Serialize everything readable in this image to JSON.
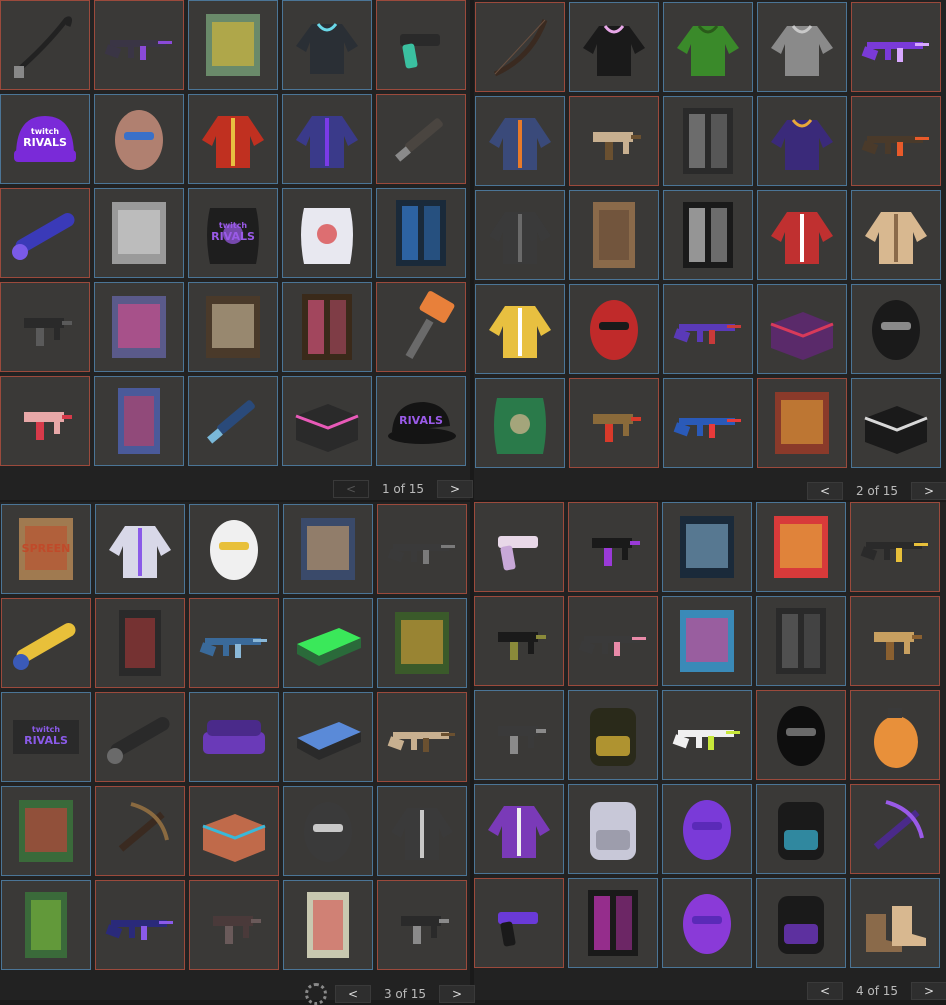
{
  "pages": [
    {
      "pager": {
        "prev": "<",
        "label": "1 of 15",
        "next": ">"
      },
      "items": [
        {
          "n": "whip-icon",
          "k": "whip",
          "f": "r",
          "c": "#222",
          "a": "#888"
        },
        {
          "n": "assault-rifle-icon",
          "k": "rifle",
          "f": "r",
          "c": "#3a3545",
          "a": "#8a4ad8"
        },
        {
          "n": "retro-sign-icon",
          "k": "sign",
          "f": "b",
          "c": "#6a8a6a",
          "a": "#e8c030"
        },
        {
          "n": "hoodie-icon",
          "k": "hoodie",
          "f": "b",
          "c": "#2a2f35",
          "a": "#6ad8e8"
        },
        {
          "n": "revolver-icon",
          "k": "pistol",
          "f": "r",
          "c": "#2a2a2a",
          "a": "#3ac0a0"
        },
        {
          "n": "beanie-icon",
          "k": "beanie",
          "f": "b",
          "c": "#7a2ad8",
          "a": "#ffffff",
          "t": "twitch\nRIVALS"
        },
        {
          "n": "welding-mask-icon",
          "k": "mask",
          "f": "b",
          "c": "#b08070",
          "a": "#3a70c8"
        },
        {
          "n": "jacket-icon",
          "k": "jacket",
          "f": "b",
          "c": "#c03020",
          "a": "#e8c040"
        },
        {
          "n": "jacket-icon",
          "k": "jacket",
          "f": "b",
          "c": "#3a3a8a",
          "a": "#7a3ae8"
        },
        {
          "n": "machete-icon",
          "k": "blade",
          "f": "r",
          "c": "#4a4540",
          "a": "#8a8a8a"
        },
        {
          "n": "rocket-launcher-icon",
          "k": "tube",
          "f": "r",
          "c": "#3a3ab8",
          "a": "#7a5ae8"
        },
        {
          "n": "rug-icon",
          "k": "sign",
          "f": "b",
          "c": "#9a9a9a",
          "a": "#d8d8d8"
        },
        {
          "n": "sleeping-bag-icon",
          "k": "bag",
          "f": "b",
          "c": "#1e1e1e",
          "a": "#9a5ae8",
          "t": "twitch\nRIVALS"
        },
        {
          "n": "sleeping-bag-icon",
          "k": "bag",
          "f": "b",
          "c": "#e8e8f0",
          "a": "#d83a3a"
        },
        {
          "n": "vending-machine-icon",
          "k": "locker",
          "f": "b",
          "c": "#1a2a3a",
          "a": "#3a8ae8"
        },
        {
          "n": "smg-icon",
          "k": "smg",
          "f": "r",
          "c": "#2a2a2a",
          "a": "#5a5a5a"
        },
        {
          "n": "poster-icon",
          "k": "sign",
          "f": "b",
          "c": "#5a5a8a",
          "a": "#e84a8a"
        },
        {
          "n": "poster-icon",
          "k": "sign",
          "f": "b",
          "c": "#4a3a2a",
          "a": "#d8c8a8"
        },
        {
          "n": "locker-icon",
          "k": "locker",
          "f": "b",
          "c": "#3a2a1a",
          "a": "#e85a8a"
        },
        {
          "n": "hammer-icon",
          "k": "hammer",
          "f": "r",
          "c": "#6a6a6a",
          "a": "#e8803a"
        },
        {
          "n": "smg-icon",
          "k": "smg",
          "f": "r",
          "c": "#e8a8a8",
          "a": "#d83a4a"
        },
        {
          "n": "door-icon",
          "k": "door",
          "f": "b",
          "c": "#4a5a9a",
          "a": "#d83a5a"
        },
        {
          "n": "launcher-icon",
          "k": "blade",
          "f": "b",
          "c": "#2a4a7a",
          "a": "#7ab8d8"
        },
        {
          "n": "storage-box-icon",
          "k": "box",
          "f": "b",
          "c": "#2a2a2a",
          "a": "#e85ab8"
        },
        {
          "n": "cap-icon",
          "k": "cap",
          "f": "b",
          "c": "#141414",
          "a": "#9a5ae8",
          "t": "RIVALS"
        }
      ]
    },
    {
      "pager": {
        "prev": "<",
        "label": "2 of 15",
        "next": ">"
      },
      "items": [
        {
          "n": "bow-icon",
          "k": "bow",
          "f": "r",
          "c": "#3a2a20",
          "a": "#6a5040"
        },
        {
          "n": "hoodie-icon",
          "k": "hoodie",
          "f": "b",
          "c": "#1a1a1a",
          "a": "#e8a8e8"
        },
        {
          "n": "hoodie-icon",
          "k": "hoodie",
          "f": "b",
          "c": "#3a8a2a",
          "a": "#2a5a1a"
        },
        {
          "n": "hoodie-icon",
          "k": "hoodie",
          "f": "b",
          "c": "#8a8a8a",
          "a": "#c8c8c8"
        },
        {
          "n": "assault-rifle-icon",
          "k": "rifle",
          "f": "r",
          "c": "#7a3ad8",
          "a": "#d8a8ff"
        },
        {
          "n": "jersey-icon",
          "k": "jacket",
          "f": "b",
          "c": "#3a4a7a",
          "a": "#e87a2a"
        },
        {
          "n": "thompson-icon",
          "k": "smg",
          "f": "r",
          "c": "#c8b090",
          "a": "#6a5030"
        },
        {
          "n": "vending-machine-icon",
          "k": "locker",
          "f": "b",
          "c": "#2a2a2a",
          "a": "#9a9a9a"
        },
        {
          "n": "hoodie-icon",
          "k": "hoodie",
          "f": "b",
          "c": "#3a2a7a",
          "a": "#e8a83a"
        },
        {
          "n": "assault-rifle-icon",
          "k": "rifle",
          "f": "r",
          "c": "#4a3a2a",
          "a": "#e85a2a"
        },
        {
          "n": "armor-icon",
          "k": "jacket",
          "f": "b",
          "c": "#3a3a3a",
          "a": "#6a6a6a"
        },
        {
          "n": "wooden-door-icon",
          "k": "door",
          "f": "b",
          "c": "#8a6a4a",
          "a": "#5a4030"
        },
        {
          "n": "vending-machine-icon",
          "k": "locker",
          "f": "b",
          "c": "#1a1a1a",
          "a": "#e8e8e8"
        },
        {
          "n": "jacket-icon",
          "k": "jacket",
          "f": "b",
          "c": "#c03030",
          "a": "#ffffff"
        },
        {
          "n": "torso-armor-icon",
          "k": "jacket",
          "f": "b",
          "c": "#d8b890",
          "a": "#8a6a4a"
        },
        {
          "n": "jacket-icon",
          "k": "jacket",
          "f": "b",
          "c": "#e8c040",
          "a": "#ffffff"
        },
        {
          "n": "mask-icon",
          "k": "mask",
          "f": "b",
          "c": "#c02a2a",
          "a": "#1a1a1a"
        },
        {
          "n": "shotgun-icon",
          "k": "rifle",
          "f": "b",
          "c": "#5a3ab8",
          "a": "#c83a3a"
        },
        {
          "n": "storage-box-icon",
          "k": "box",
          "f": "b",
          "c": "#5a2a6a",
          "a": "#d83a5a"
        },
        {
          "n": "bandana-icon",
          "k": "mask",
          "f": "b",
          "c": "#1a1a1a",
          "a": "#8a8a8a"
        },
        {
          "n": "sleeping-bag-icon",
          "k": "bag",
          "f": "b",
          "c": "#2a7a4a",
          "a": "#d8b890"
        },
        {
          "n": "smg-icon",
          "k": "smg",
          "f": "r",
          "c": "#8a6a3a",
          "a": "#d83a2a"
        },
        {
          "n": "assault-rifle-icon",
          "k": "rifle",
          "f": "b",
          "c": "#2a5ab8",
          "a": "#e83a3a"
        },
        {
          "n": "wall-poster-icon",
          "k": "sign",
          "f": "r",
          "c": "#8a3a2a",
          "a": "#e8a83a"
        },
        {
          "n": "crate-icon",
          "k": "box",
          "f": "b",
          "c": "#1a1a1a",
          "a": "#d8d8d8"
        }
      ]
    },
    {
      "pager": {
        "prev": "<",
        "label": "3 of 15",
        "next": ">"
      },
      "items": [
        {
          "n": "sign-icon",
          "k": "sign",
          "f": "b",
          "c": "#a07a50",
          "a": "#c04a2a",
          "t": "SPREEN"
        },
        {
          "n": "armor-vest-icon",
          "k": "jacket",
          "f": "b",
          "c": "#d8d8e8",
          "a": "#8a5ae8"
        },
        {
          "n": "helmet-icon",
          "k": "mask",
          "f": "b",
          "c": "#f0f0f0",
          "a": "#e8c03a"
        },
        {
          "n": "poster-icon",
          "k": "sign",
          "f": "b",
          "c": "#3a4a6a",
          "a": "#d8a86a"
        },
        {
          "n": "assault-rifle-icon",
          "k": "rifle",
          "f": "r",
          "c": "#3a3a3a",
          "a": "#7a7a7a"
        },
        {
          "n": "rocket-launcher-icon",
          "k": "tube",
          "f": "r",
          "c": "#e8c03a",
          "a": "#3a5ab8"
        },
        {
          "n": "metal-door-icon",
          "k": "door",
          "f": "r",
          "c": "#2a2a2a",
          "a": "#c03a3a"
        },
        {
          "n": "shotgun-icon",
          "k": "rifle",
          "f": "r",
          "c": "#3a6a9a",
          "a": "#8ab8d8"
        },
        {
          "n": "bed-icon",
          "k": "bed",
          "f": "b",
          "c": "#2a6a3a",
          "a": "#3ae85a"
        },
        {
          "n": "poster-icon",
          "k": "sign",
          "f": "b",
          "c": "#3a5a2a",
          "a": "#e8a83a"
        },
        {
          "n": "twitch-rivals-sign-icon",
          "k": "logo",
          "f": "b",
          "c": "#2a2a2a",
          "a": "#8a5ae8",
          "t": "twitch\nRIVALS"
        },
        {
          "n": "pistol-icon",
          "k": "tube",
          "f": "r",
          "c": "#2a2a2a",
          "a": "#6a6a6a"
        },
        {
          "n": "sofa-icon",
          "k": "sofa",
          "f": "b",
          "c": "#6a3ab8",
          "a": "#4a2a8a"
        },
        {
          "n": "bed-icon",
          "k": "bed",
          "f": "b",
          "c": "#2a2a2a",
          "a": "#5a8ad8"
        },
        {
          "n": "bolt-rifle-icon",
          "k": "rifle",
          "f": "r",
          "c": "#c8b090",
          "a": "#6a5030"
        },
        {
          "n": "sign-icon",
          "k": "sign",
          "f": "b",
          "c": "#3a6a3a",
          "a": "#d83a3a"
        },
        {
          "n": "crossbow-icon",
          "k": "crossbow",
          "f": "r",
          "c": "#3a2a20",
          "a": "#8a6a40"
        },
        {
          "n": "storage-box-icon",
          "k": "box",
          "f": "r",
          "c": "#c06a4a",
          "a": "#3ab8d8"
        },
        {
          "n": "bandana-icon",
          "k": "mask",
          "f": "b",
          "c": "#3a3a3a",
          "a": "#c8c8c8"
        },
        {
          "n": "armor-icon",
          "k": "jacket",
          "f": "b",
          "c": "#3a3a3a",
          "a": "#c8c8c8"
        },
        {
          "n": "metal-door-icon",
          "k": "door",
          "f": "b",
          "c": "#3a6a3a",
          "a": "#8ac83a"
        },
        {
          "n": "assault-rifle-icon",
          "k": "rifle",
          "f": "r",
          "c": "#2a2a7a",
          "a": "#8a5ae8"
        },
        {
          "n": "smg-icon",
          "k": "smg",
          "f": "r",
          "c": "#4a3a3a",
          "a": "#6a5a5a"
        },
        {
          "n": "wooden-door-icon",
          "k": "door",
          "f": "b",
          "c": "#c8c8b0",
          "a": "#d83a3a"
        },
        {
          "n": "smg-icon",
          "k": "smg",
          "f": "r",
          "c": "#2a2a2a",
          "a": "#8a8a8a"
        }
      ]
    },
    {
      "pager": {
        "prev": "<",
        "label": "4 of 15",
        "next": ">"
      },
      "items": [
        {
          "n": "pistol-icon",
          "k": "pistol",
          "f": "r",
          "c": "#e8d8e8",
          "a": "#c8a8d8"
        },
        {
          "n": "smg-icon",
          "k": "smg",
          "f": "r",
          "c": "#1a1a1a",
          "a": "#9a3ad8"
        },
        {
          "n": "poster-icon",
          "k": "sign",
          "f": "b",
          "c": "#1a2a3a",
          "a": "#8ab8d8"
        },
        {
          "n": "poster-icon",
          "k": "sign",
          "f": "b",
          "c": "#d83a3a",
          "a": "#e8c03a"
        },
        {
          "n": "assault-rifle-icon",
          "k": "rifle",
          "f": "r",
          "c": "#2a2a2a",
          "a": "#e8c03a"
        },
        {
          "n": "smg-icon",
          "k": "smg",
          "f": "r",
          "c": "#1a1a1a",
          "a": "#8a8a3a"
        },
        {
          "n": "shotgun-icon",
          "k": "rifle",
          "f": "r",
          "c": "#3a3a3a",
          "a": "#e88aa8"
        },
        {
          "n": "poster-icon",
          "k": "sign",
          "f": "b",
          "c": "#3a8ab8",
          "a": "#e83a8a"
        },
        {
          "n": "vending-machine-icon",
          "k": "locker",
          "f": "b",
          "c": "#2a2a2a",
          "a": "#6a6a6a"
        },
        {
          "n": "thompson-icon",
          "k": "smg",
          "f": "r",
          "c": "#c8a060",
          "a": "#8a6030"
        },
        {
          "n": "smg-icon",
          "k": "smg",
          "f": "b",
          "c": "#3a3a3a",
          "a": "#8a8a8a"
        },
        {
          "n": "backpack-icon",
          "k": "backpack",
          "f": "b",
          "c": "#2a2a1a",
          "a": "#e8c03a"
        },
        {
          "n": "assault-rifle-icon",
          "k": "rifle",
          "f": "b",
          "c": "#f0f0f0",
          "a": "#c8e83a"
        },
        {
          "n": "helmet-icon",
          "k": "mask",
          "f": "r",
          "c": "#0e0e0e",
          "a": "#6a6a6a"
        },
        {
          "n": "grenade-icon",
          "k": "grenade",
          "f": "r",
          "c": "#e8903a",
          "a": "#3a3a3a"
        },
        {
          "n": "varsity-jacket-icon",
          "k": "jacket",
          "f": "b",
          "c": "#7a3ab8",
          "a": "#f0f0f0"
        },
        {
          "n": "backpack-icon",
          "k": "backpack",
          "f": "b",
          "c": "#c8c8d8",
          "a": "#8a8a9a"
        },
        {
          "n": "bandana-icon",
          "k": "mask",
          "f": "b",
          "c": "#7a3ad8",
          "a": "#5a2ab8"
        },
        {
          "n": "backpack-icon",
          "k": "backpack",
          "f": "b",
          "c": "#1a1a1a",
          "a": "#3ab8d8"
        },
        {
          "n": "crossbow-icon",
          "k": "crossbow",
          "f": "r",
          "c": "#4a2a8a",
          "a": "#9a5ae8"
        },
        {
          "n": "pistol-icon",
          "k": "pistol",
          "f": "r",
          "c": "#6a3ad8",
          "a": "#1a1a1a"
        },
        {
          "n": "vending-machine-icon",
          "k": "locker",
          "f": "b",
          "c": "#1a1a1a",
          "a": "#e83ad8"
        },
        {
          "n": "bandana-icon",
          "k": "mask",
          "f": "b",
          "c": "#8a3ad8",
          "a": "#5a2ab8"
        },
        {
          "n": "backpack-icon",
          "k": "backpack",
          "f": "b",
          "c": "#1a1a1a",
          "a": "#7a3ad8"
        },
        {
          "n": "boots-icon",
          "k": "boots",
          "f": "b",
          "c": "#8a6a4a",
          "a": "#d8b890"
        }
      ]
    }
  ]
}
